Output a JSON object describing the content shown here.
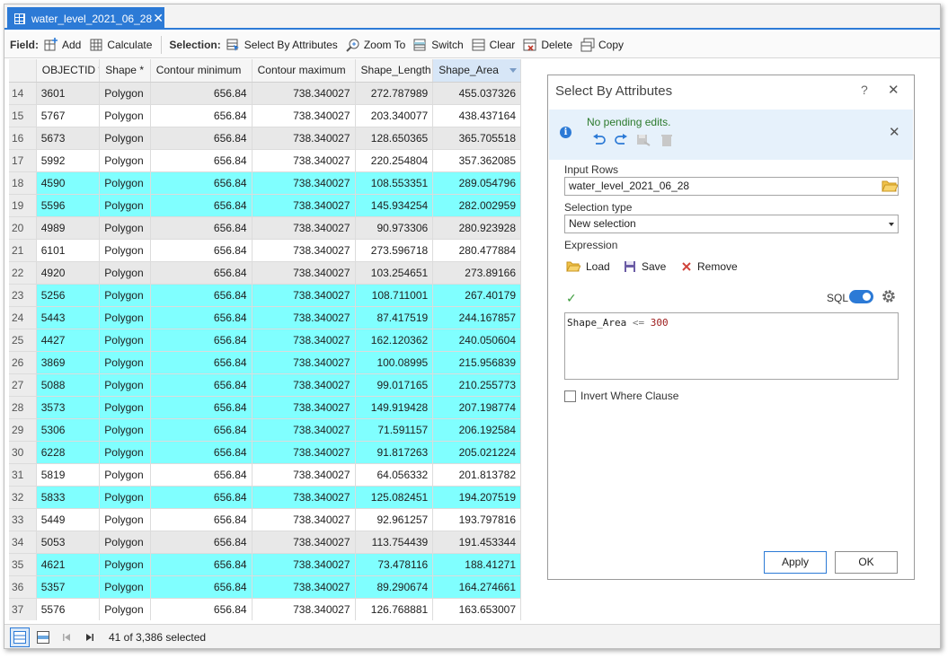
{
  "tab": {
    "title": "water_level_2021_06_28",
    "close": "✕"
  },
  "toolbar": {
    "field_label": "Field:",
    "add": "Add",
    "calculate": "Calculate",
    "selection_label": "Selection:",
    "select_by_attributes": "Select By Attributes",
    "zoom_to": "Zoom To",
    "switch": "Switch",
    "clear": "Clear",
    "delete": "Delete",
    "copy": "Copy"
  },
  "table": {
    "columns": [
      "OBJECTID *",
      "Shape *",
      "Contour minimum",
      "Contour maximum",
      "Shape_Length",
      "Shape_Area"
    ],
    "sorted_column": "Shape_Area",
    "rows": [
      {
        "n": "14",
        "id": "3601",
        "shape": "Polygon",
        "cmin": "656.84",
        "cmax": "738.340027",
        "len": "272.787989",
        "area": "455.037326",
        "state": "alt"
      },
      {
        "n": "15",
        "id": "5767",
        "shape": "Polygon",
        "cmin": "656.84",
        "cmax": "738.340027",
        "len": "203.340077",
        "area": "438.437164",
        "state": "plain"
      },
      {
        "n": "16",
        "id": "5673",
        "shape": "Polygon",
        "cmin": "656.84",
        "cmax": "738.340027",
        "len": "128.650365",
        "area": "365.705518",
        "state": "alt"
      },
      {
        "n": "17",
        "id": "5992",
        "shape": "Polygon",
        "cmin": "656.84",
        "cmax": "738.340027",
        "len": "220.254804",
        "area": "357.362085",
        "state": "plain"
      },
      {
        "n": "18",
        "id": "4590",
        "shape": "Polygon",
        "cmin": "656.84",
        "cmax": "738.340027",
        "len": "108.553351",
        "area": "289.054796",
        "state": "sel"
      },
      {
        "n": "19",
        "id": "5596",
        "shape": "Polygon",
        "cmin": "656.84",
        "cmax": "738.340027",
        "len": "145.934254",
        "area": "282.002959",
        "state": "sel"
      },
      {
        "n": "20",
        "id": "4989",
        "shape": "Polygon",
        "cmin": "656.84",
        "cmax": "738.340027",
        "len": "90.973306",
        "area": "280.923928",
        "state": "alt"
      },
      {
        "n": "21",
        "id": "6101",
        "shape": "Polygon",
        "cmin": "656.84",
        "cmax": "738.340027",
        "len": "273.596718",
        "area": "280.477884",
        "state": "plain"
      },
      {
        "n": "22",
        "id": "4920",
        "shape": "Polygon",
        "cmin": "656.84",
        "cmax": "738.340027",
        "len": "103.254651",
        "area": "273.89166",
        "state": "alt"
      },
      {
        "n": "23",
        "id": "5256",
        "shape": "Polygon",
        "cmin": "656.84",
        "cmax": "738.340027",
        "len": "108.711001",
        "area": "267.40179",
        "state": "sel"
      },
      {
        "n": "24",
        "id": "5443",
        "shape": "Polygon",
        "cmin": "656.84",
        "cmax": "738.340027",
        "len": "87.417519",
        "area": "244.167857",
        "state": "sel"
      },
      {
        "n": "25",
        "id": "4427",
        "shape": "Polygon",
        "cmin": "656.84",
        "cmax": "738.340027",
        "len": "162.120362",
        "area": "240.050604",
        "state": "sel"
      },
      {
        "n": "26",
        "id": "3869",
        "shape": "Polygon",
        "cmin": "656.84",
        "cmax": "738.340027",
        "len": "100.08995",
        "area": "215.956839",
        "state": "sel"
      },
      {
        "n": "27",
        "id": "5088",
        "shape": "Polygon",
        "cmin": "656.84",
        "cmax": "738.340027",
        "len": "99.017165",
        "area": "210.255773",
        "state": "sel"
      },
      {
        "n": "28",
        "id": "3573",
        "shape": "Polygon",
        "cmin": "656.84",
        "cmax": "738.340027",
        "len": "149.919428",
        "area": "207.198774",
        "state": "sel"
      },
      {
        "n": "29",
        "id": "5306",
        "shape": "Polygon",
        "cmin": "656.84",
        "cmax": "738.340027",
        "len": "71.591157",
        "area": "206.192584",
        "state": "sel"
      },
      {
        "n": "30",
        "id": "6228",
        "shape": "Polygon",
        "cmin": "656.84",
        "cmax": "738.340027",
        "len": "91.817263",
        "area": "205.021224",
        "state": "sel"
      },
      {
        "n": "31",
        "id": "5819",
        "shape": "Polygon",
        "cmin": "656.84",
        "cmax": "738.340027",
        "len": "64.056332",
        "area": "201.813782",
        "state": "plain"
      },
      {
        "n": "32",
        "id": "5833",
        "shape": "Polygon",
        "cmin": "656.84",
        "cmax": "738.340027",
        "len": "125.082451",
        "area": "194.207519",
        "state": "sel"
      },
      {
        "n": "33",
        "id": "5449",
        "shape": "Polygon",
        "cmin": "656.84",
        "cmax": "738.340027",
        "len": "92.961257",
        "area": "193.797816",
        "state": "plain"
      },
      {
        "n": "34",
        "id": "5053",
        "shape": "Polygon",
        "cmin": "656.84",
        "cmax": "738.340027",
        "len": "113.754439",
        "area": "191.453344",
        "state": "alt"
      },
      {
        "n": "35",
        "id": "4621",
        "shape": "Polygon",
        "cmin": "656.84",
        "cmax": "738.340027",
        "len": "73.478116",
        "area": "188.41271",
        "state": "sel"
      },
      {
        "n": "36",
        "id": "5357",
        "shape": "Polygon",
        "cmin": "656.84",
        "cmax": "738.340027",
        "len": "89.290674",
        "area": "164.274661",
        "state": "sel"
      },
      {
        "n": "37",
        "id": "5576",
        "shape": "Polygon",
        "cmin": "656.84",
        "cmax": "738.340027",
        "len": "126.768881",
        "area": "163.653007",
        "state": "plain"
      }
    ]
  },
  "status": {
    "selected_text": "41 of 3,386 selected"
  },
  "dialog": {
    "title": "Select By Attributes",
    "help": "?",
    "close": "✕",
    "message": "No pending edits.",
    "input_rows_label": "Input Rows",
    "input_rows_value": "water_level_2021_06_28",
    "selection_type_label": "Selection type",
    "selection_type_value": "New selection",
    "expression_label": "Expression",
    "load": "Load",
    "save": "Save",
    "remove": "Remove",
    "sql_label": "SQL",
    "expr_field": "Shape_Area",
    "expr_op": "<=",
    "expr_value": "300",
    "invert_label": "Invert Where Clause",
    "apply": "Apply",
    "ok": "OK"
  },
  "colors": {
    "accent": "#2c7ad6",
    "selected_row": "#80ffff",
    "alt_row": "#e8e8e8",
    "status_ok": "#2c7a2c"
  }
}
